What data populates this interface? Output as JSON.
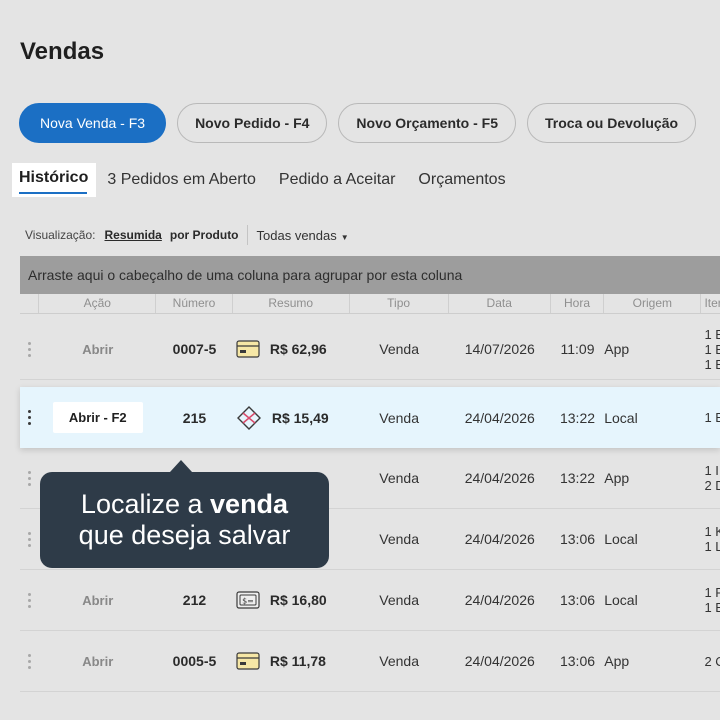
{
  "page": {
    "title": "Vendas"
  },
  "actions": [
    {
      "label": "Nova Venda - F3",
      "primary": true
    },
    {
      "label": "Novo Pedido - F4"
    },
    {
      "label": "Novo Orçamento - F5"
    },
    {
      "label": "Troca ou Devolução"
    }
  ],
  "tabs": [
    {
      "label": "Histórico",
      "active": true
    },
    {
      "label": "3 Pedidos em Aberto"
    },
    {
      "label": "Pedido a Aceitar"
    },
    {
      "label": "Orçamentos"
    }
  ],
  "view": {
    "label": "Visualização:",
    "option_summary": "Resumida",
    "option_product": "por Produto",
    "filter": "Todas vendas"
  },
  "group_bar": {
    "text": "Arraste aqui o cabeçalho de uma coluna para agrupar por esta coluna"
  },
  "columns": [
    "Ação",
    "Número",
    "Resumo",
    "Tipo",
    "Data",
    "Hora",
    "Origem",
    "Iter"
  ],
  "rows": [
    {
      "action": "Abrir",
      "number": "0007-5",
      "payment_icon": "card-icon",
      "amount": "R$ 62,96",
      "type": "Venda",
      "date": "14/07/2026",
      "time": "11:09",
      "origin": "App",
      "items": [
        "1 B",
        "1 B",
        "1 B"
      ]
    },
    {
      "action": "Abrir - F2",
      "number": "215",
      "payment_icon": "pix-icon",
      "amount": "R$ 15,49",
      "type": "Venda",
      "date": "24/04/2026",
      "time": "13:22",
      "origin": "Local",
      "items": [
        "1 B"
      ],
      "highlight": true
    },
    {
      "action": "",
      "number": "",
      "payment_icon": "",
      "amount": "",
      "type": "Venda",
      "date": "24/04/2026",
      "time": "13:22",
      "origin": "App",
      "items": [
        "1 I",
        "2 D"
      ]
    },
    {
      "action": "",
      "number": "",
      "payment_icon": "",
      "amount": "",
      "type": "Venda",
      "date": "24/04/2026",
      "time": "13:06",
      "origin": "Local",
      "items": [
        "1 K",
        "1 L"
      ]
    },
    {
      "action": "Abrir",
      "number": "212",
      "payment_icon": "cash-icon",
      "amount": "R$ 16,80",
      "type": "Venda",
      "date": "24/04/2026",
      "time": "13:06",
      "origin": "Local",
      "items": [
        "1 P",
        "1 B"
      ]
    },
    {
      "action": "Abrir",
      "number": "0005-5",
      "payment_icon": "card-icon",
      "amount": "R$ 11,78",
      "type": "Venda",
      "date": "24/04/2026",
      "time": "13:06",
      "origin": "App",
      "items": [
        "2 C"
      ]
    }
  ],
  "tooltip": {
    "line1_prefix": "Localize a",
    "line1_bold": "venda",
    "line2": "que deseja salvar"
  },
  "colors": {
    "primary": "#1b6fc4",
    "tooltip_bg": "#2e3b48",
    "highlight_row": "#e6f5fd",
    "group_bar": "#9d9d9d"
  }
}
